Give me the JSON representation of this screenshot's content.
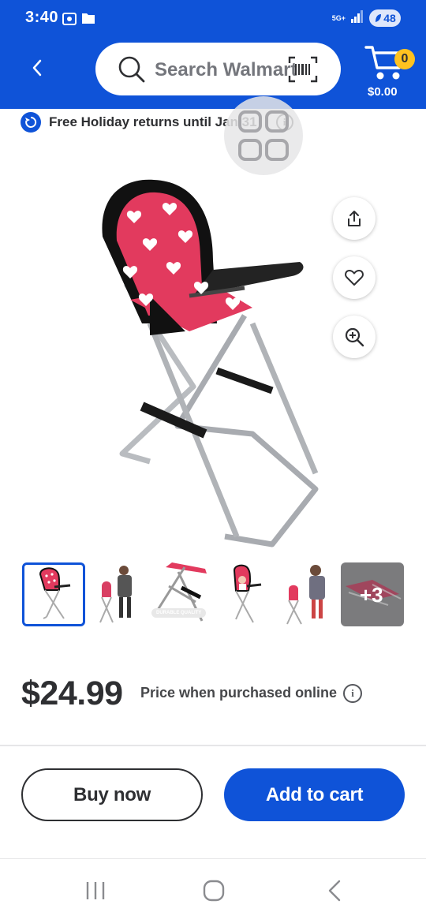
{
  "status": {
    "time": "3:40",
    "network": "5G+",
    "battery": "48"
  },
  "header": {
    "search_placeholder": "Search Walmart",
    "cart_count": "0",
    "cart_total": "$0.00"
  },
  "returns_banner": {
    "text": "Free Holiday returns until Jan 31"
  },
  "product": {
    "image_actions": [
      "share-icon",
      "heart-icon",
      "zoom-in-icon"
    ],
    "thumbnails": [
      {
        "name": "chair-front",
        "selected": true
      },
      {
        "name": "girl-with-chair",
        "selected": false
      },
      {
        "name": "chair-legs-durable",
        "selected": false,
        "badge": "DURABLE QUALITY"
      },
      {
        "name": "chair-with-doll",
        "selected": false
      },
      {
        "name": "girl-feeding-doll",
        "selected": false
      }
    ],
    "more_label": "+3",
    "price": "$24.99",
    "price_note": "Price when purchased online"
  },
  "actions": {
    "buy_now": "Buy now",
    "add_to_cart": "Add to cart"
  },
  "colors": {
    "brand_blue": "#0f53d8",
    "spark_yellow": "#ffc220",
    "text_dark": "#2e2f32"
  }
}
